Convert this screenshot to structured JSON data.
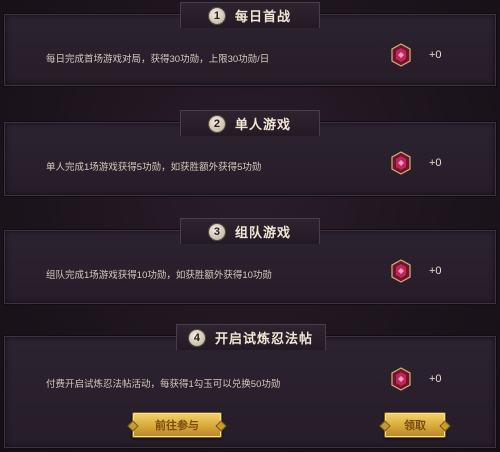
{
  "sections": [
    {
      "number": "1",
      "title": "每日首战",
      "description": "每日完成首场游戏对局，获得30功勋，上限30功勋/日",
      "reward": "+0"
    },
    {
      "number": "2",
      "title": "单人游戏",
      "description": "单人完成1场游戏获得5功勋，如获胜额外获得5功勋",
      "reward": "+0"
    },
    {
      "number": "3",
      "title": "组队游戏",
      "description": "组队完成1场游戏获得10功勋，如获胜额外获得10功勋",
      "reward": "+0"
    },
    {
      "number": "4",
      "title": "开启试炼忍法帖",
      "description": "付费开启试炼忍法帖活动，每获得1勾玉可以兑换50功勋",
      "reward": "+0"
    }
  ],
  "buttons": {
    "goto": "前往参与",
    "claim": "领取"
  },
  "icons": {
    "reward": "medal-gem-icon"
  },
  "colors": {
    "gold": "#d7a93a",
    "gem": "#c0265a"
  }
}
